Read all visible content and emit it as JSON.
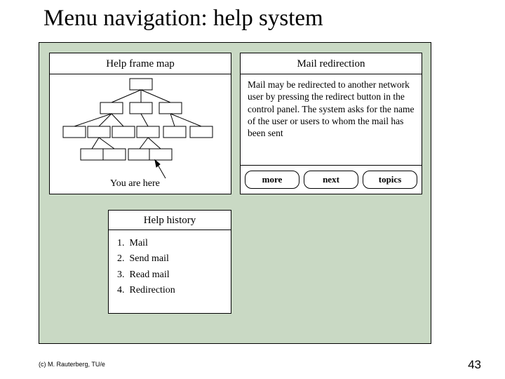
{
  "title": "Menu navigation: help system",
  "frame_map": {
    "title": "Help frame map",
    "you_are_here": "You are here"
  },
  "mail": {
    "title": "Mail redirection",
    "body": "Mail may be redirected to another network user by pressing the redirect button in the control panel. The system asks for the name of the user or users to whom the mail has been sent",
    "buttons": {
      "more": "more",
      "next": "next",
      "topics": "topics"
    }
  },
  "history": {
    "title": "Help history",
    "items": [
      "Mail",
      "Send mail",
      "Read mail",
      "Redirection"
    ]
  },
  "footer": {
    "copyright": "(c) M. Rauterberg, TU/e",
    "page": "43"
  }
}
